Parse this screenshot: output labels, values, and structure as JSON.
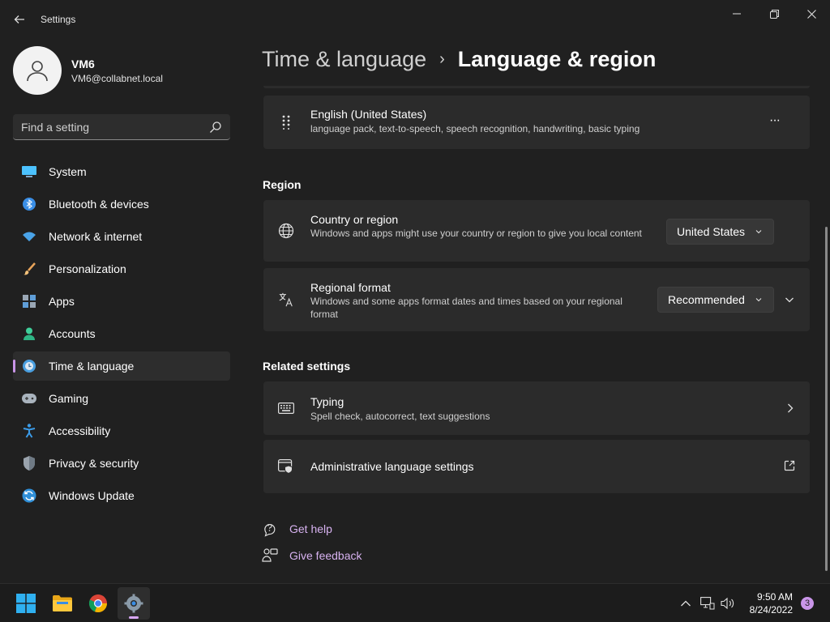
{
  "window": {
    "title": "Settings"
  },
  "profile": {
    "name": "VM6",
    "email": "VM6@collabnet.local"
  },
  "search": {
    "placeholder": "Find a setting"
  },
  "sidebar": {
    "items": [
      {
        "label": "System",
        "icon": "system-icon"
      },
      {
        "label": "Bluetooth & devices",
        "icon": "bluetooth-icon"
      },
      {
        "label": "Network & internet",
        "icon": "wifi-icon"
      },
      {
        "label": "Personalization",
        "icon": "brush-icon"
      },
      {
        "label": "Apps",
        "icon": "apps-icon"
      },
      {
        "label": "Accounts",
        "icon": "accounts-icon"
      },
      {
        "label": "Time & language",
        "icon": "time-language-icon",
        "active": true
      },
      {
        "label": "Gaming",
        "icon": "gaming-icon"
      },
      {
        "label": "Accessibility",
        "icon": "accessibility-icon"
      },
      {
        "label": "Privacy & security",
        "icon": "shield-icon"
      },
      {
        "label": "Windows Update",
        "icon": "update-icon"
      }
    ]
  },
  "breadcrumb": {
    "parent": "Time & language",
    "separator": "›",
    "current": "Language & region"
  },
  "language_card": {
    "title": "English (United States)",
    "description": "language pack, text-to-speech, speech recognition, handwriting, basic typing",
    "more": "···"
  },
  "region": {
    "heading": "Region",
    "country": {
      "title": "Country or region",
      "description": "Windows and apps might use your country or region to give you local content",
      "value": "United States"
    },
    "format": {
      "title": "Regional format",
      "description": "Windows and some apps format dates and times based on your regional format",
      "value": "Recommended"
    }
  },
  "related": {
    "heading": "Related settings",
    "typing": {
      "title": "Typing",
      "description": "Spell check, autocorrect, text suggestions"
    },
    "admin": {
      "title": "Administrative language settings"
    }
  },
  "help": {
    "get_help": "Get help",
    "give_feedback": "Give feedback"
  },
  "taskbar": {
    "apps": [
      "start-icon",
      "file-explorer-icon",
      "chrome-icon",
      "settings-icon"
    ],
    "time": "9:50 AM",
    "date": "8/24/2022",
    "notifications": "3"
  },
  "colors": {
    "accent": "#c995e8",
    "link": "#d7b2f0",
    "background": "#202020",
    "card": "#2b2b2b"
  }
}
